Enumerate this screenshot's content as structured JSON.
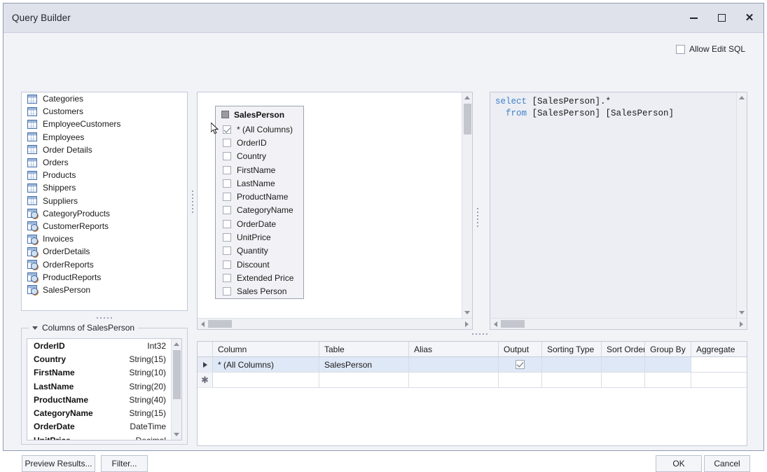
{
  "window": {
    "title": "Query Builder",
    "minimize_label": "Minimize",
    "maximize_label": "Maximize",
    "close_label": "Close"
  },
  "edit_sql": {
    "label": "Allow Edit SQL",
    "checked": false
  },
  "object_list": {
    "items": [
      {
        "label": "Categories",
        "icon": "table-icon"
      },
      {
        "label": "Customers",
        "icon": "table-icon"
      },
      {
        "label": "EmployeeCustomers",
        "icon": "table-icon"
      },
      {
        "label": "Employees",
        "icon": "table-icon"
      },
      {
        "label": "Order Details",
        "icon": "table-icon"
      },
      {
        "label": "Orders",
        "icon": "table-icon"
      },
      {
        "label": "Products",
        "icon": "table-icon"
      },
      {
        "label": "Shippers",
        "icon": "table-icon"
      },
      {
        "label": "Suppliers",
        "icon": "table-icon"
      },
      {
        "label": "CategoryProducts",
        "icon": "view-icon"
      },
      {
        "label": "CustomerReports",
        "icon": "view-icon"
      },
      {
        "label": "Invoices",
        "icon": "view-icon"
      },
      {
        "label": "OrderDetails",
        "icon": "view-icon"
      },
      {
        "label": "OrderReports",
        "icon": "view-icon"
      },
      {
        "label": "ProductReports",
        "icon": "view-icon"
      },
      {
        "label": "SalesPerson",
        "icon": "view-icon"
      }
    ]
  },
  "columns_panel": {
    "caption": "Columns of SalesPerson",
    "rows": [
      {
        "name": "OrderID",
        "type": "Int32"
      },
      {
        "name": "Country",
        "type": "String(15)"
      },
      {
        "name": "FirstName",
        "type": "String(10)"
      },
      {
        "name": "LastName",
        "type": "String(20)"
      },
      {
        "name": "ProductName",
        "type": "String(40)"
      },
      {
        "name": "CategoryName",
        "type": "String(15)"
      },
      {
        "name": "OrderDate",
        "type": "DateTime"
      },
      {
        "name": "UnitPrice",
        "type": "Decimal"
      }
    ]
  },
  "diagram": {
    "table": {
      "name": "SalesPerson",
      "fields": [
        {
          "label": "* (All Columns)",
          "checked": true
        },
        {
          "label": "OrderID",
          "checked": false
        },
        {
          "label": "Country",
          "checked": false
        },
        {
          "label": "FirstName",
          "checked": false
        },
        {
          "label": "LastName",
          "checked": false
        },
        {
          "label": "ProductName",
          "checked": false
        },
        {
          "label": "CategoryName",
          "checked": false
        },
        {
          "label": "OrderDate",
          "checked": false
        },
        {
          "label": "UnitPrice",
          "checked": false
        },
        {
          "label": "Quantity",
          "checked": false
        },
        {
          "label": "Discount",
          "checked": false
        },
        {
          "label": "Extended Price",
          "checked": false
        },
        {
          "label": "Sales Person",
          "checked": false
        }
      ]
    }
  },
  "sql": {
    "line1_keyword": "select",
    "line1_rest": " [SalesPerson].*",
    "line2_keyword": "  from",
    "line2_rest": " [SalesPerson] [SalesPerson]",
    "keyword_color": "#3f7fc7"
  },
  "grid": {
    "headers": [
      "Column",
      "Table",
      "Alias",
      "Output",
      "Sorting Type",
      "Sort Order",
      "Group By",
      "Aggregate"
    ],
    "rows": [
      {
        "selected": true,
        "indicator": "row-selector-arrow",
        "column": "* (All Columns)",
        "table": "SalesPerson",
        "alias": "",
        "output_checked": true,
        "sorting_type": "",
        "sort_order": "",
        "group_by": "",
        "aggregate": ""
      },
      {
        "selected": false,
        "indicator": "new-row-asterisk",
        "column": "",
        "table": "",
        "alias": "",
        "output_checked": false,
        "sorting_type": "",
        "sort_order": "",
        "group_by": "",
        "aggregate": ""
      }
    ]
  },
  "footer": {
    "preview": "Preview Results...",
    "filter": "Filter...",
    "ok": "OK",
    "cancel": "Cancel"
  },
  "colors": {
    "window_bg": "#eceef4",
    "titlebar": "#dfe2ea",
    "selection": "#dfe8f6",
    "border": "#c2c8d6"
  }
}
